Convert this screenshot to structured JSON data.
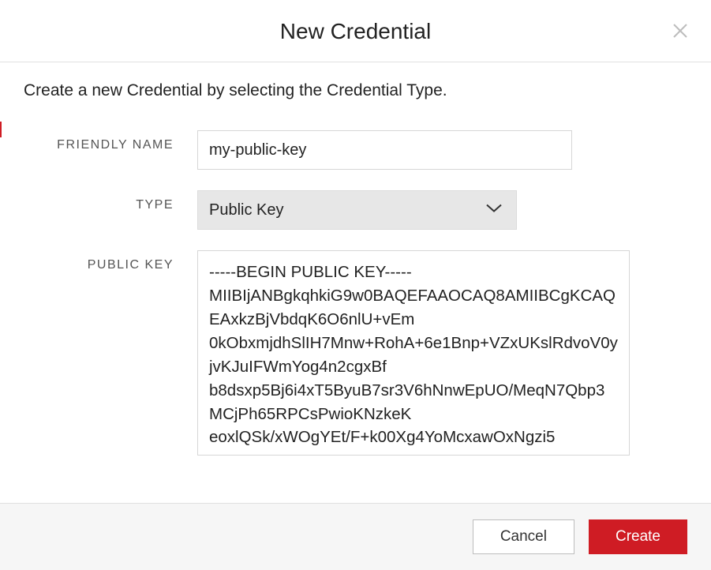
{
  "header": {
    "title": "New Credential"
  },
  "body": {
    "description": "Create a new Credential by selecting the Credential Type.",
    "fields": {
      "friendly_name": {
        "label": "FRIENDLY NAME",
        "value": "my-public-key"
      },
      "type": {
        "label": "TYPE",
        "value": "Public Key"
      },
      "public_key": {
        "label": "PUBLIC KEY",
        "value": "-----BEGIN PUBLIC KEY-----\nMIIBIjANBgkqhkiG9w0BAQEFAAOCAQ8AMIIBCgKCAQEAxkzBjVbdqK6O6nlU+vEm\n0kObxmjdhSlIH7Mnw+RohA+6e1Bnp+VZxUKslRdvoV0yjvKJuIFWmYog4n2cgxBf\nb8dsxp5Bj6i4xT5ByuB7sr3V6hNnwEpUO/MeqN7Qbp3MCjPh65RPCsPwioKNzkeK\neoxlQSk/xWOgYEt/F+k00Xg4YoMcxawOxNgzi5"
      }
    }
  },
  "footer": {
    "cancel_label": "Cancel",
    "create_label": "Create"
  }
}
